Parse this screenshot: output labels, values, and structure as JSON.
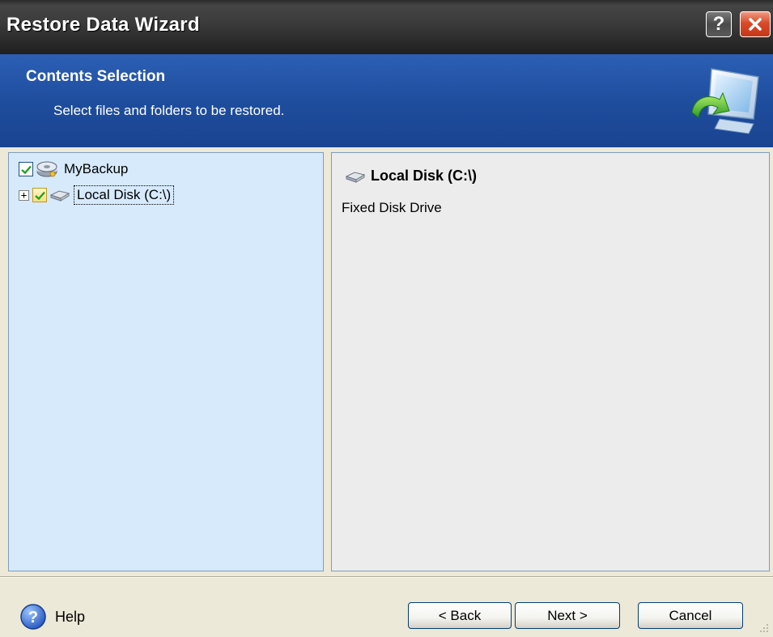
{
  "window": {
    "title": "Restore Data Wizard",
    "help_glyph": "?",
    "close_glyph": "✕"
  },
  "header": {
    "title": "Contents Selection",
    "subtitle": "Select files and folders to be restored.",
    "icon": "restore-monitor-icon"
  },
  "tree": {
    "items": [
      {
        "label": "MyBackup",
        "checked": true,
        "icon": "backup-disk-icon",
        "expander": ""
      },
      {
        "label": "Local Disk (C:\\)",
        "checked": true,
        "icon": "hard-drive-icon",
        "expander": "+",
        "focused": true
      }
    ]
  },
  "details": {
    "title": "Local Disk (C:\\)",
    "description": "Fixed Disk Drive",
    "icon": "hard-drive-icon"
  },
  "footer": {
    "help_label": "Help",
    "back_label": "< Back",
    "next_label": "Next >",
    "cancel_label": "Cancel"
  },
  "colors": {
    "titlebar": "#3c3c3c",
    "header_blue": "#1e4c9c",
    "tree_background": "#d6eafc",
    "details_background": "#ececec",
    "dialog_background": "#ece9d8"
  }
}
